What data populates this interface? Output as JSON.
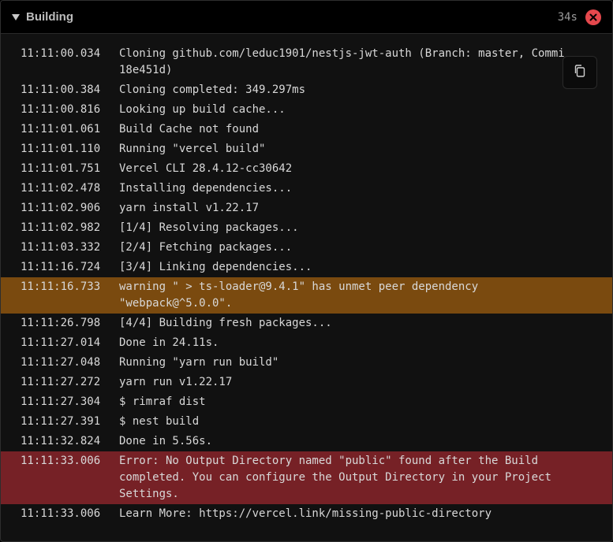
{
  "header": {
    "title": "Building",
    "duration": "34s"
  },
  "colors": {
    "warning_row": "#7a4a0f",
    "error_row": "#762126",
    "status_error": "#e5484d"
  },
  "log": [
    {
      "ts": "11:11:00.034",
      "msg": "Cloning github.com/leduc1901/nestjs-jwt-auth (Branch: master, Commi\n18e451d)",
      "level": "info"
    },
    {
      "ts": "11:11:00.384",
      "msg": "Cloning completed: 349.297ms",
      "level": "info"
    },
    {
      "ts": "11:11:00.816",
      "msg": "Looking up build cache...",
      "level": "info"
    },
    {
      "ts": "11:11:01.061",
      "msg": "Build Cache not found",
      "level": "info"
    },
    {
      "ts": "11:11:01.110",
      "msg": "Running \"vercel build\"",
      "level": "info"
    },
    {
      "ts": "11:11:01.751",
      "msg": "Vercel CLI 28.4.12-cc30642",
      "level": "info"
    },
    {
      "ts": "11:11:02.478",
      "msg": "Installing dependencies...",
      "level": "info"
    },
    {
      "ts": "11:11:02.906",
      "msg": "yarn install v1.22.17",
      "level": "info"
    },
    {
      "ts": "11:11:02.982",
      "msg": "[1/4] Resolving packages...",
      "level": "info"
    },
    {
      "ts": "11:11:03.332",
      "msg": "[2/4] Fetching packages...",
      "level": "info"
    },
    {
      "ts": "11:11:16.724",
      "msg": "[3/4] Linking dependencies...",
      "level": "info"
    },
    {
      "ts": "11:11:16.733",
      "msg": "warning \" > ts-loader@9.4.1\" has unmet peer dependency\n\"webpack@^5.0.0\".",
      "level": "warning"
    },
    {
      "ts": "11:11:26.798",
      "msg": "[4/4] Building fresh packages...",
      "level": "info"
    },
    {
      "ts": "11:11:27.014",
      "msg": "Done in 24.11s.",
      "level": "info"
    },
    {
      "ts": "11:11:27.048",
      "msg": "Running \"yarn run build\"",
      "level": "info"
    },
    {
      "ts": "11:11:27.272",
      "msg": "yarn run v1.22.17",
      "level": "info"
    },
    {
      "ts": "11:11:27.304",
      "msg": "$ rimraf dist",
      "level": "info"
    },
    {
      "ts": "11:11:27.391",
      "msg": "$ nest build",
      "level": "info"
    },
    {
      "ts": "11:11:32.824",
      "msg": "Done in 5.56s.",
      "level": "info"
    },
    {
      "ts": "11:11:33.006",
      "msg": "Error: No Output Directory named \"public\" found after the Build\ncompleted. You can configure the Output Directory in your Project\nSettings.",
      "level": "error"
    },
    {
      "ts": "11:11:33.006",
      "msg": "Learn More: https://vercel.link/missing-public-directory",
      "level": "info"
    }
  ]
}
